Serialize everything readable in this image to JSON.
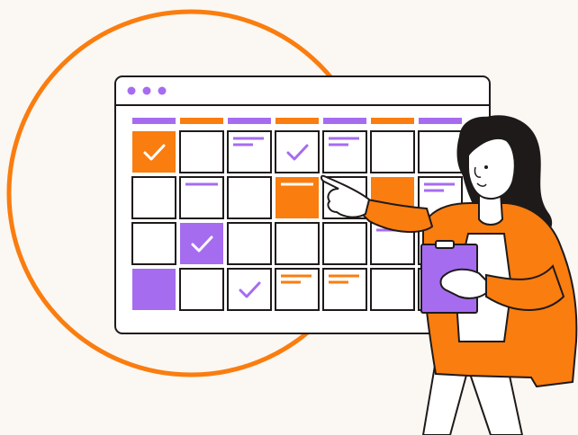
{
  "colors": {
    "background": "#fbf7f2",
    "orange": "#fa7d0f",
    "purple": "#a66cf0",
    "outline": "#1f1a1a",
    "white": "#ffffff"
  },
  "window": {
    "dots": [
      "dot-1",
      "dot-2",
      "dot-3"
    ],
    "header_bars": [
      "purple",
      "orange",
      "purple",
      "orange",
      "purple",
      "orange",
      "purple"
    ]
  },
  "calendar": {
    "cells": [
      [
        {
          "fill": "orange",
          "mark": "check"
        },
        {
          "fill": "white",
          "mark": "none"
        },
        {
          "fill": "white",
          "mark": "lines-purple"
        },
        {
          "fill": "white",
          "mark": "check"
        },
        {
          "fill": "white",
          "mark": "lines-purple"
        },
        {
          "fill": "white",
          "mark": "none"
        },
        {
          "fill": "white",
          "mark": "none"
        }
      ],
      [
        {
          "fill": "white",
          "mark": "none"
        },
        {
          "fill": "white",
          "mark": "line-purple"
        },
        {
          "fill": "white",
          "mark": "none"
        },
        {
          "fill": "orange",
          "mark": "line-white"
        },
        {
          "fill": "white",
          "mark": "none"
        },
        {
          "fill": "orange",
          "mark": "none"
        },
        {
          "fill": "white",
          "mark": "lines-purple"
        }
      ],
      [
        {
          "fill": "white",
          "mark": "none"
        },
        {
          "fill": "purple",
          "mark": "check"
        },
        {
          "fill": "white",
          "mark": "none"
        },
        {
          "fill": "white",
          "mark": "none"
        },
        {
          "fill": "white",
          "mark": "none"
        },
        {
          "fill": "white",
          "mark": "line-purple"
        },
        {
          "fill": "white",
          "mark": "none"
        }
      ],
      [
        {
          "fill": "purple",
          "mark": "none"
        },
        {
          "fill": "white",
          "mark": "none"
        },
        {
          "fill": "white",
          "mark": "check"
        },
        {
          "fill": "white",
          "mark": "lines-orange"
        },
        {
          "fill": "white",
          "mark": "lines-orange"
        },
        {
          "fill": "white",
          "mark": "none"
        },
        {
          "fill": "white",
          "mark": "none"
        }
      ]
    ]
  },
  "icons": {
    "check": "check-icon",
    "clipboard": "clipboard-icon"
  }
}
